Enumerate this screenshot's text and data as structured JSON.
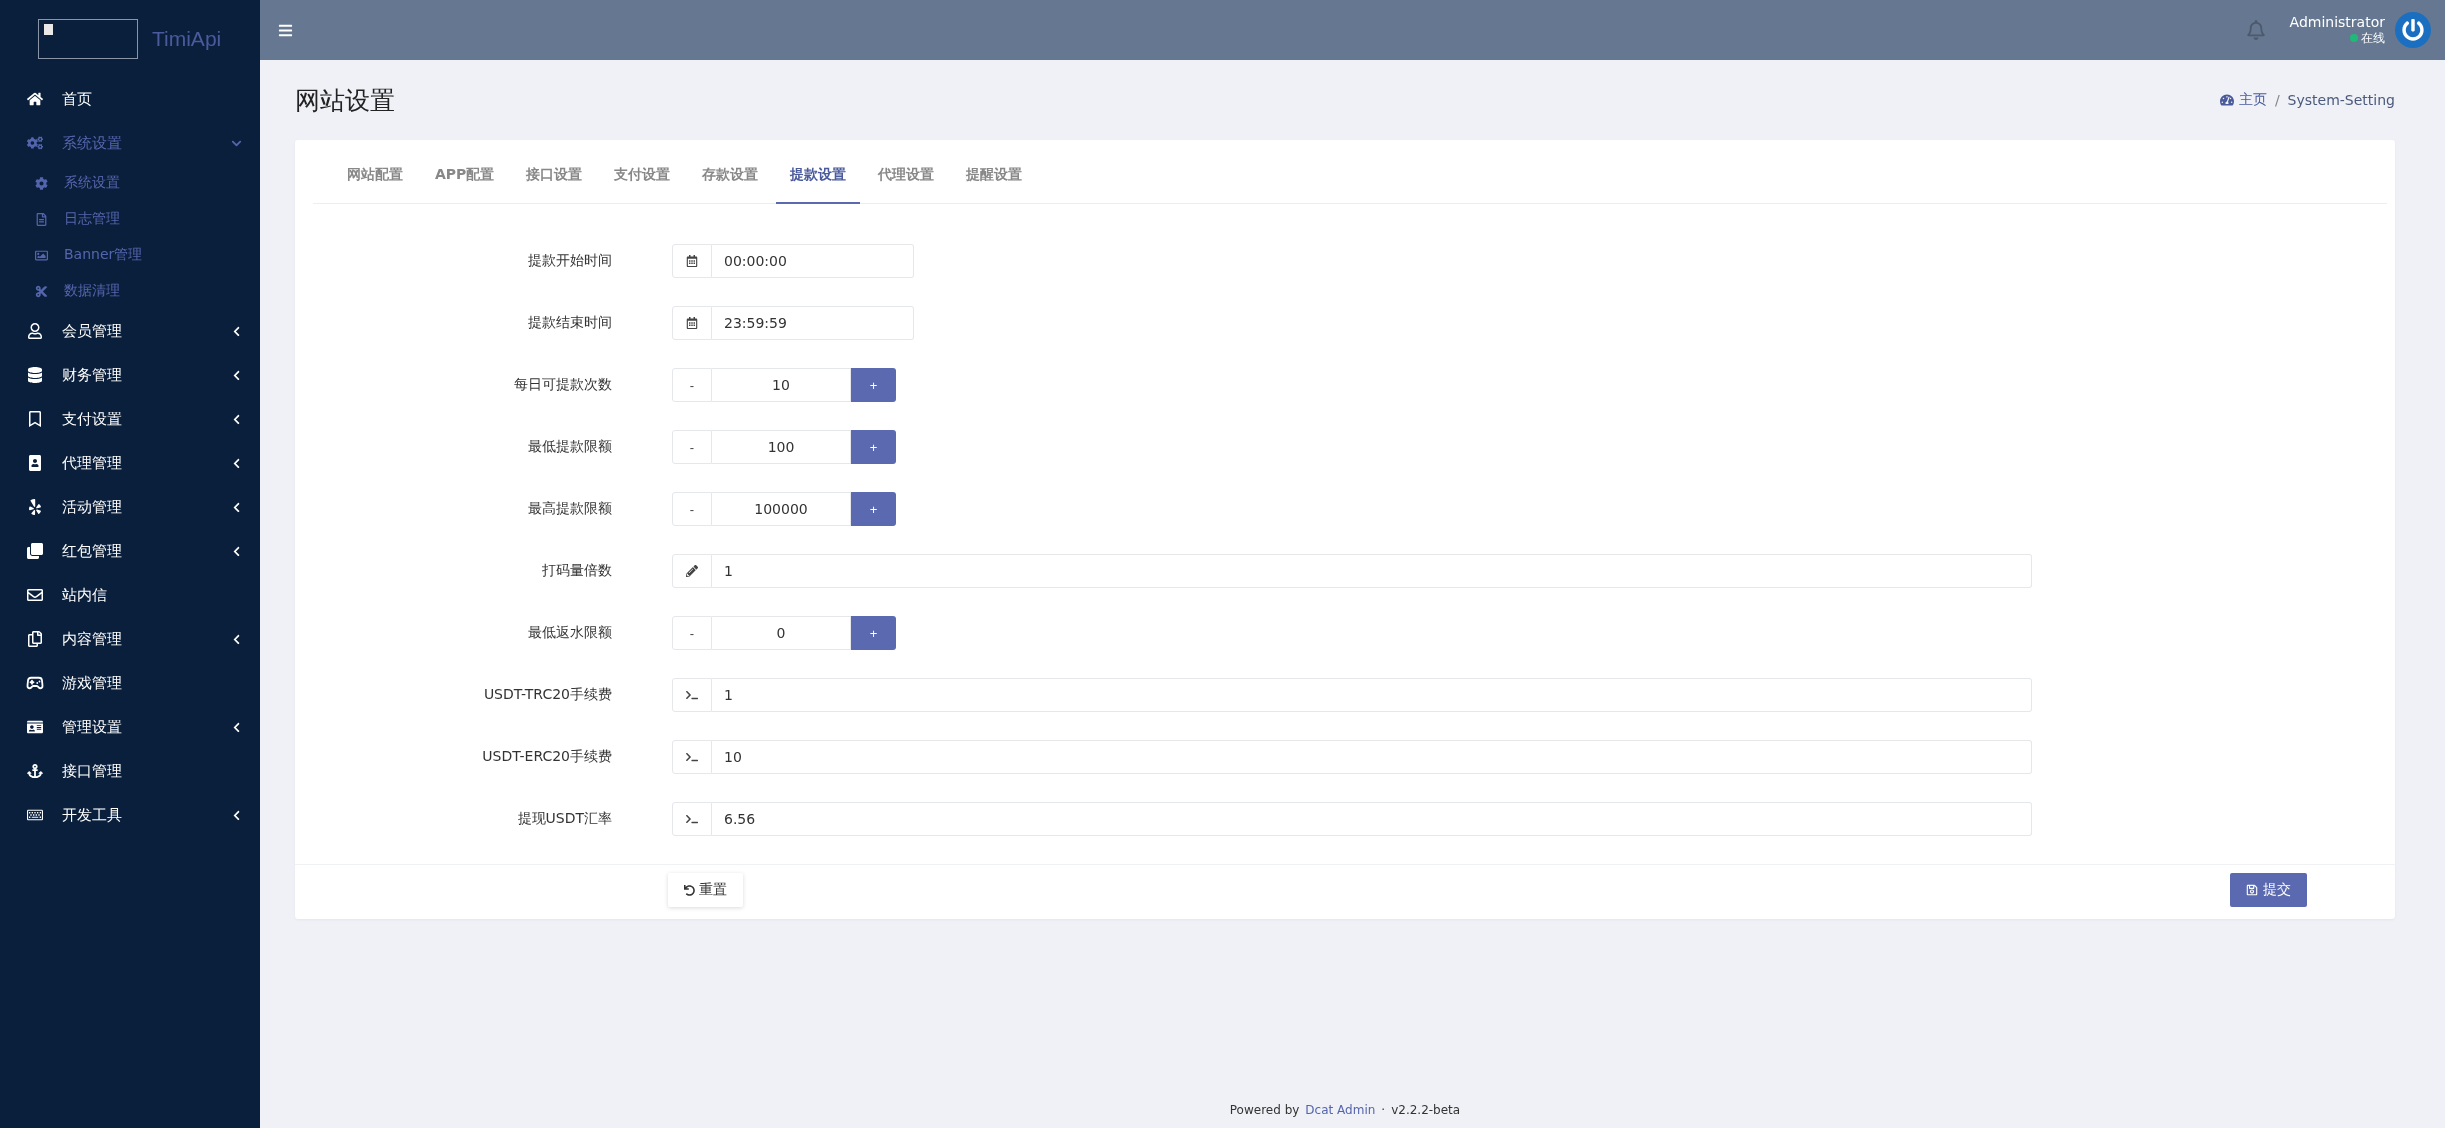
{
  "sidebar": {
    "logo_text": "TimiApi",
    "items": [
      {
        "label": "首页"
      },
      {
        "label": "系统设置",
        "expanded": true,
        "children": [
          {
            "label": "系统设置"
          },
          {
            "label": "日志管理"
          },
          {
            "label": "Banner管理"
          },
          {
            "label": "数据清理"
          }
        ]
      },
      {
        "label": "会员管理",
        "expanded": false
      },
      {
        "label": "财务管理",
        "expanded": false
      },
      {
        "label": "支付设置",
        "expanded": false
      },
      {
        "label": "代理管理",
        "expanded": false
      },
      {
        "label": "活动管理",
        "expanded": false
      },
      {
        "label": "红包管理",
        "expanded": false
      },
      {
        "label": "站内信"
      },
      {
        "label": "内容管理",
        "expanded": false
      },
      {
        "label": "游戏管理"
      },
      {
        "label": "管理设置",
        "expanded": false
      },
      {
        "label": "接口管理"
      },
      {
        "label": "开发工具",
        "expanded": false
      }
    ]
  },
  "topbar": {
    "user_name": "Administrator",
    "status": "在线"
  },
  "page": {
    "title": "网站设置",
    "breadcrumb": [
      "主页",
      "System-Setting"
    ],
    "breadcrumb_separator": "/"
  },
  "tabs": [
    {
      "label": "网站配置",
      "selected": false
    },
    {
      "label": "APP配置",
      "selected": false
    },
    {
      "label": "接口设置",
      "selected": false
    },
    {
      "label": "支付设置",
      "selected": false
    },
    {
      "label": "存款设置",
      "selected": false
    },
    {
      "label": "提款设置",
      "selected": true
    },
    {
      "label": "代理设置",
      "selected": false
    },
    {
      "label": "提醒设置",
      "selected": false
    }
  ],
  "form": [
    {
      "label": "提款开始时间",
      "kind": "time",
      "value": "00:00:00"
    },
    {
      "label": "提款结束时间",
      "kind": "time",
      "value": "23:59:59"
    },
    {
      "label": "每日可提款次数",
      "kind": "number",
      "value": "10",
      "minus": "-",
      "plus": "+"
    },
    {
      "label": "最低提款限额",
      "kind": "number",
      "value": "100",
      "minus": "-",
      "plus": "+"
    },
    {
      "label": "最高提款限额",
      "kind": "number",
      "value": "100000",
      "minus": "-",
      "plus": "+"
    },
    {
      "label": "打码量倍数",
      "kind": "text",
      "value": "1"
    },
    {
      "label": "最低返水限额",
      "kind": "number",
      "value": "0",
      "minus": "-",
      "plus": "+"
    },
    {
      "label": "USDT-TRC20手续费",
      "kind": "code",
      "value": "1"
    },
    {
      "label": "USDT-ERC20手续费",
      "kind": "code",
      "value": "10"
    },
    {
      "label": "提现USDT汇率",
      "kind": "code",
      "value": "6.56"
    }
  ],
  "buttons": {
    "reset": "重置",
    "submit": "提交"
  },
  "footer": {
    "prefix": "Powered by",
    "link": "Dcat Admin",
    "separator": "·",
    "version": "v2.2.2-beta"
  }
}
